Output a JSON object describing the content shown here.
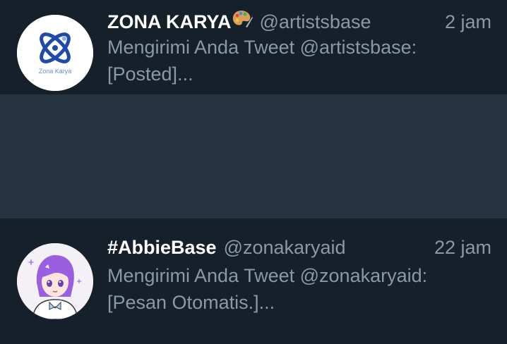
{
  "colors": {
    "background": "#15202b",
    "divider": "#263340",
    "name": "#ffffff",
    "secondary_text": "#8b98a5"
  },
  "conversations": [
    {
      "avatar_icon": "zona-karya-logo",
      "avatar_text": "Zona Karya",
      "name": "ZONA KARYA",
      "name_emoji": "artist-palette-icon",
      "handle": "@artistsbase",
      "time": "2 jam",
      "preview": "Mengirimi Anda Tweet @artistsbase: [Posted]..."
    },
    {
      "avatar_icon": "anime-girl-avatar",
      "name": "#AbbieBase",
      "handle": "@zonakaryaid",
      "time": "22 jam",
      "preview": "Mengirimi Anda Tweet @zonakaryaid: [Pesan Otomatis.]..."
    }
  ]
}
